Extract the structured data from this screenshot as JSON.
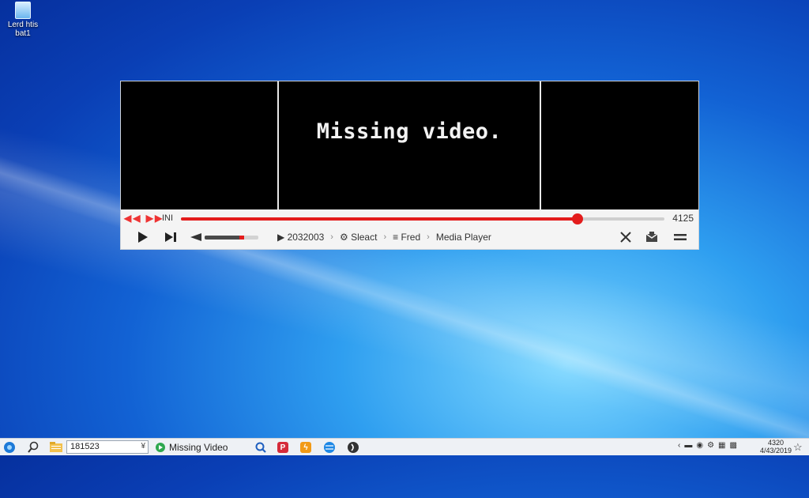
{
  "desktop": {
    "icon_label": "Lerd htis\nbat1"
  },
  "player": {
    "message": "Missing video.",
    "seek": {
      "left_label": "INI",
      "time": "4125",
      "progress": 0.82
    },
    "volume_level": 0.74,
    "breadcrumbs": {
      "item1": "2032003",
      "item2": "Sleact",
      "item3": "Fred",
      "item4": "Media Player"
    },
    "colors": {
      "accent": "#e31c1c"
    }
  },
  "taskbar": {
    "search_value": "181523",
    "search_suffix": "¥",
    "app_label": "Missing Video",
    "clock_time": "4320",
    "clock_date": "4/43/2019"
  }
}
